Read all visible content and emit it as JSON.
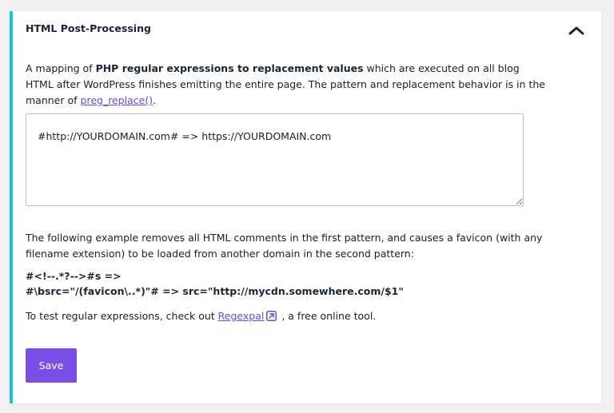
{
  "panel": {
    "title": "HTML Post-Processing",
    "accent_color": "#1fc1d3",
    "toggle_icon": "chevron-up-icon"
  },
  "intro": {
    "text_before": "A mapping of ",
    "bold_text": "PHP regular expressions to replacement values",
    "text_after": " which are executed on all blog HTML after WordPress finishes emitting the entire page. The pattern and replacement behavior is in the manner of ",
    "link_text": "preg_replace()",
    "text_end": "."
  },
  "mapping_field": {
    "value": "#http://YOURDOMAIN.com# => https://YOURDOMAIN.com"
  },
  "example": {
    "description": "The following example removes all HTML comments in the first pattern, and causes a favicon (with any filename extension) to be loaded from another domain in the second pattern:",
    "line1": "#<!--.*?-->#s =>",
    "line2": "#\\bsrc=\"/(favicon\\..*)\"# => src=\"http://mycdn.somewhere.com/$1\""
  },
  "test": {
    "text_before": "To test regular expressions, check out ",
    "link_text": "Regexpal",
    "link_icon": "external-link-icon",
    "text_after": " , a free online tool."
  },
  "save_button": {
    "label": "Save",
    "color": "#7a4fe8"
  },
  "colors": {
    "link": "#6a4ad8"
  }
}
